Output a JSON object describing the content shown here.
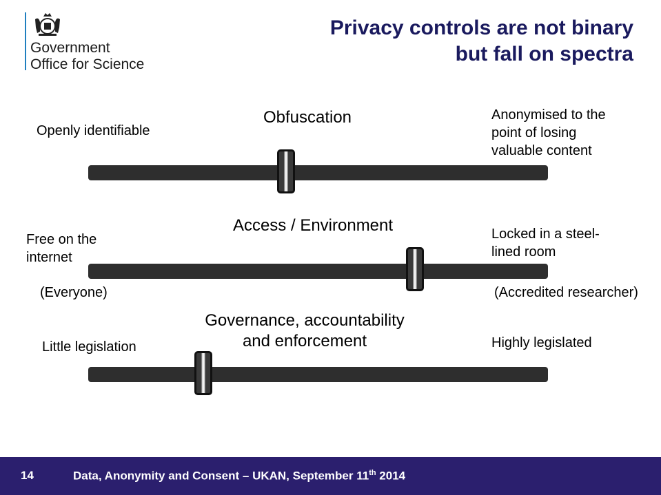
{
  "logo": {
    "line1": "Government",
    "line2": "Office for Science"
  },
  "title": {
    "line1": "Privacy controls are not binary",
    "line2": "but fall on spectra"
  },
  "spectra": [
    {
      "heading": "Obfuscation",
      "left_label": "Openly identifiable",
      "right_label": [
        "Anonymised  to the",
        "point of losing",
        "valuable content"
      ],
      "position_fraction": 0.43
    },
    {
      "heading": "Access / Environment",
      "left_label": [
        "Free on the",
        "internet"
      ],
      "right_label": [
        "Locked in a steel-",
        "lined room"
      ],
      "left_note": "(Everyone)",
      "right_note": "(Accredited researcher)",
      "position_fraction": 0.71
    },
    {
      "heading": [
        "Governance, accountability",
        "and enforcement"
      ],
      "left_label": "Little legislation",
      "right_label": "Highly legislated",
      "position_fraction": 0.25
    }
  ],
  "footer": {
    "page_number": "14",
    "text_before": "Data, Anonymity and Consent – UKAN, September 11",
    "superscript": "th",
    "text_after": " 2014"
  },
  "colors": {
    "title": "#1a1a5e",
    "footer_bg": "#2b1f6e",
    "logo_rule": "#1f7fbf",
    "track": "#2e2e2e"
  }
}
